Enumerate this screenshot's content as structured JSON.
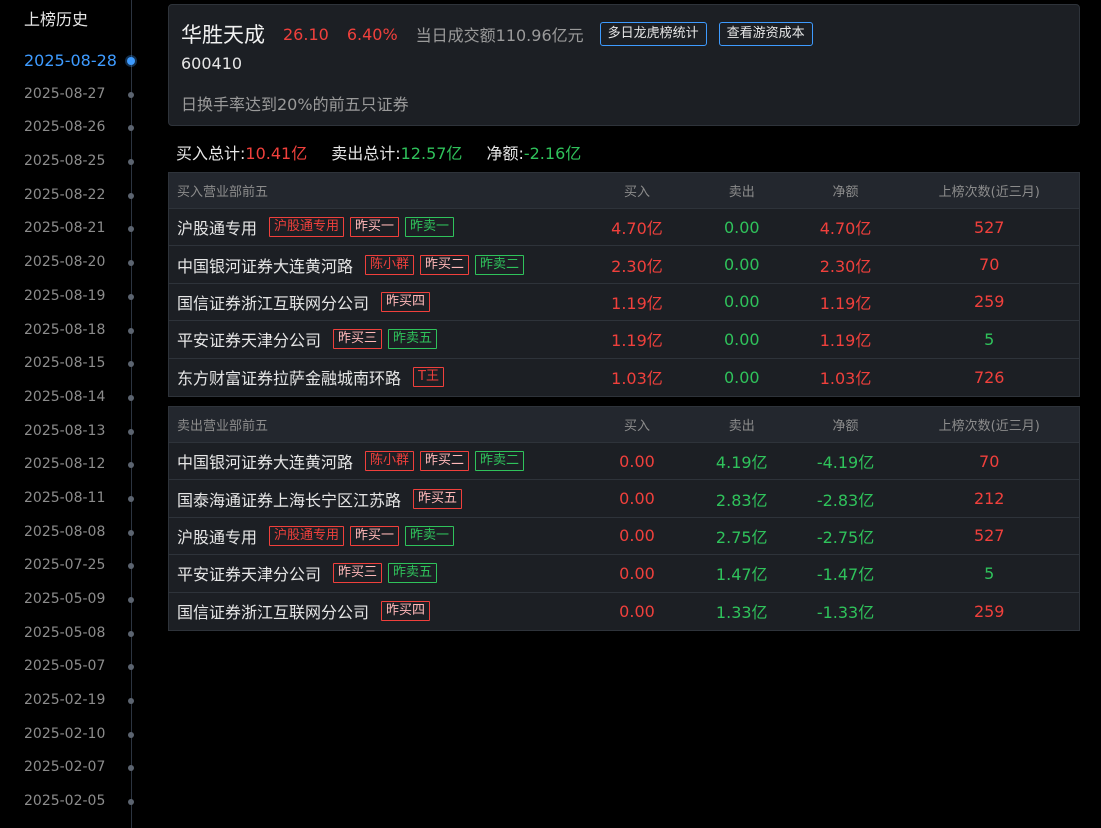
{
  "sidebar": {
    "title": "上榜历史",
    "dates": [
      "2025-08-28",
      "2025-08-27",
      "2025-08-26",
      "2025-08-25",
      "2025-08-22",
      "2025-08-21",
      "2025-08-20",
      "2025-08-19",
      "2025-08-18",
      "2025-08-15",
      "2025-08-14",
      "2025-08-13",
      "2025-08-12",
      "2025-08-11",
      "2025-08-08",
      "2025-07-25",
      "2025-05-09",
      "2025-05-08",
      "2025-05-07",
      "2025-02-19",
      "2025-02-10",
      "2025-02-07",
      "2025-02-05"
    ],
    "active_index": 0
  },
  "header": {
    "stock_name": "华胜天成",
    "price": "26.10",
    "change_pct": "6.40%",
    "turnover": "当日成交额110.96亿元",
    "btn_multi_day": "多日龙虎榜统计",
    "btn_cost": "查看游资成本",
    "stock_code": "600410",
    "reason": "日换手率达到20%的前五只证券"
  },
  "summary": {
    "buy_label": "买入总计:",
    "buy_value": "10.41亿",
    "sell_label": "卖出总计:",
    "sell_value": "12.57亿",
    "net_label": "净额:",
    "net_value": "-2.16亿"
  },
  "buy_table": {
    "headers": [
      "买入营业部前五",
      "买入",
      "卖出",
      "净额",
      "上榜次数(近三月)"
    ],
    "rows": [
      {
        "name": "沪股通专用",
        "tags": [
          {
            "text": "沪股通专用",
            "style": "red"
          },
          {
            "text": "昨买一",
            "style": "pink"
          },
          {
            "text": "昨卖一",
            "style": "green"
          }
        ],
        "buy": "4.70亿",
        "sell": "0.00",
        "net": "4.70亿",
        "count": "527",
        "count_color": "red"
      },
      {
        "name": "中国银河证券大连黄河路",
        "tags": [
          {
            "text": "陈小群",
            "style": "red"
          },
          {
            "text": "昨买二",
            "style": "pink"
          },
          {
            "text": "昨卖二",
            "style": "green"
          }
        ],
        "buy": "2.30亿",
        "sell": "0.00",
        "net": "2.30亿",
        "count": "70",
        "count_color": "red"
      },
      {
        "name": "国信证券浙江互联网分公司",
        "tags": [
          {
            "text": "昨买四",
            "style": "pink"
          }
        ],
        "buy": "1.19亿",
        "sell": "0.00",
        "net": "1.19亿",
        "count": "259",
        "count_color": "red"
      },
      {
        "name": "平安证券天津分公司",
        "tags": [
          {
            "text": "昨买三",
            "style": "pink"
          },
          {
            "text": "昨卖五",
            "style": "green"
          }
        ],
        "buy": "1.19亿",
        "sell": "0.00",
        "net": "1.19亿",
        "count": "5",
        "count_color": "green"
      },
      {
        "name": "东方财富证券拉萨金融城南环路",
        "tags": [
          {
            "text": "T王",
            "style": "red"
          }
        ],
        "buy": "1.03亿",
        "sell": "0.00",
        "net": "1.03亿",
        "count": "726",
        "count_color": "red"
      }
    ]
  },
  "sell_table": {
    "headers": [
      "卖出营业部前五",
      "买入",
      "卖出",
      "净额",
      "上榜次数(近三月)"
    ],
    "rows": [
      {
        "name": "中国银河证券大连黄河路",
        "tags": [
          {
            "text": "陈小群",
            "style": "red"
          },
          {
            "text": "昨买二",
            "style": "pink"
          },
          {
            "text": "昨卖二",
            "style": "green"
          }
        ],
        "buy": "0.00",
        "sell": "4.19亿",
        "net": "-4.19亿",
        "count": "70",
        "count_color": "red"
      },
      {
        "name": "国泰海通证券上海长宁区江苏路",
        "tags": [
          {
            "text": "昨买五",
            "style": "pink"
          }
        ],
        "buy": "0.00",
        "sell": "2.83亿",
        "net": "-2.83亿",
        "count": "212",
        "count_color": "red"
      },
      {
        "name": "沪股通专用",
        "tags": [
          {
            "text": "沪股通专用",
            "style": "red"
          },
          {
            "text": "昨买一",
            "style": "pink"
          },
          {
            "text": "昨卖一",
            "style": "green"
          }
        ],
        "buy": "0.00",
        "sell": "2.75亿",
        "net": "-2.75亿",
        "count": "527",
        "count_color": "red"
      },
      {
        "name": "平安证券天津分公司",
        "tags": [
          {
            "text": "昨买三",
            "style": "pink"
          },
          {
            "text": "昨卖五",
            "style": "green"
          }
        ],
        "buy": "0.00",
        "sell": "1.47亿",
        "net": "-1.47亿",
        "count": "5",
        "count_color": "green"
      },
      {
        "name": "国信证券浙江互联网分公司",
        "tags": [
          {
            "text": "昨买四",
            "style": "pink"
          }
        ],
        "buy": "0.00",
        "sell": "1.33亿",
        "net": "-1.33亿",
        "count": "259",
        "count_color": "red"
      }
    ]
  }
}
